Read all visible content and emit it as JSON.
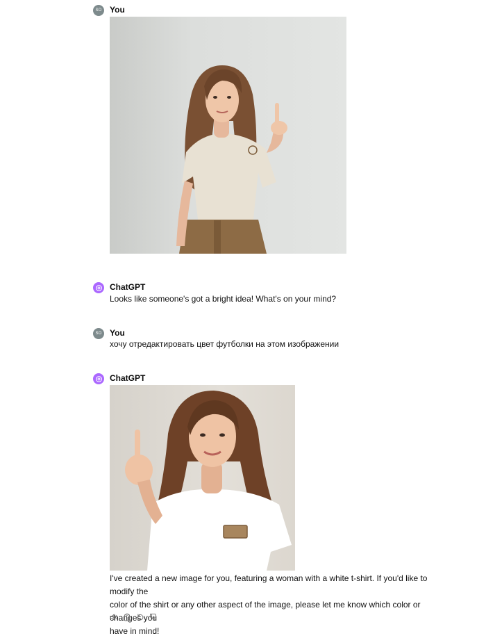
{
  "messages": [
    {
      "role": "user",
      "author": "You",
      "avatar_initials": "SO",
      "attachment": "photo of woman pointing finger up"
    },
    {
      "role": "assistant",
      "author": "ChatGPT",
      "text": "Looks like someone's got a bright idea! What's on your mind?"
    },
    {
      "role": "user",
      "author": "You",
      "avatar_initials": "SO",
      "text": "хочу отредактировать цвет футболки на этом изображении"
    },
    {
      "role": "assistant",
      "author": "ChatGPT",
      "attachment": "generated image of woman in white t-shirt",
      "text_lines": [
        "I've created a new image for you, featuring a woman with a white t-shirt. If you'd like to modify the",
        "color of the shirt or any other aspect of the image, please let me know which color or changes you",
        "have in mind!"
      ]
    }
  ],
  "actions": [
    "read-aloud-icon",
    "copy-icon",
    "regenerate-icon",
    "thumbs-down-icon"
  ],
  "colors": {
    "user_avatar": "#7d8a8c",
    "assistant_avatar": "#ab68ff"
  }
}
